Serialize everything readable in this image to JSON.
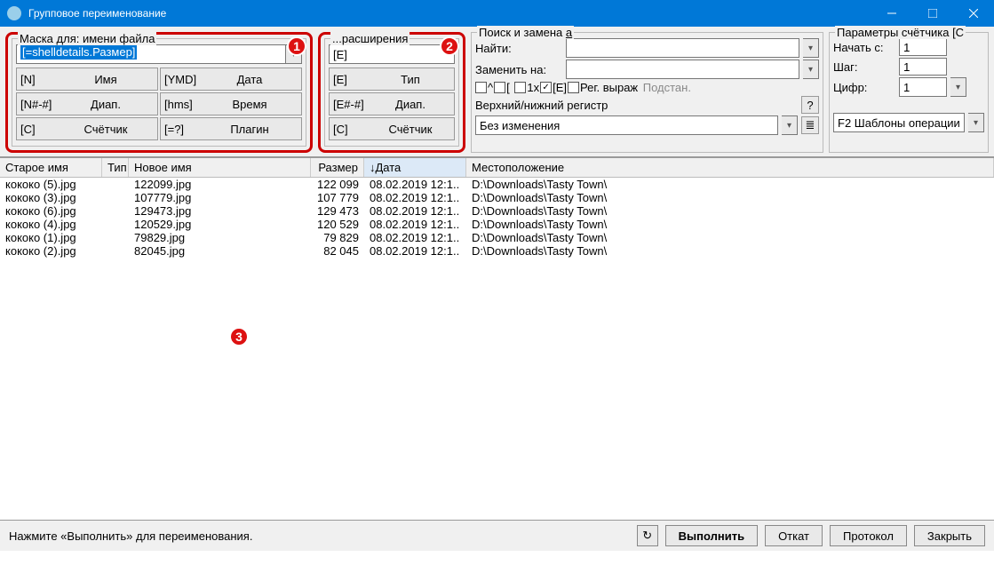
{
  "window": {
    "title": "Групповое переименование"
  },
  "badges": {
    "b1": "1",
    "b2": "2",
    "b3": "3"
  },
  "filename_mask": {
    "title": "Маска для: имени файла",
    "value": "[=shelldetails.Размер]",
    "buttons": [
      {
        "tag": "[N]",
        "label": "Имя"
      },
      {
        "tag": "[YMD]",
        "label": "Дата"
      },
      {
        "tag": "[N#-#]",
        "label": "Диап."
      },
      {
        "tag": "[hms]",
        "label": "Время"
      },
      {
        "tag": "[C]",
        "label": "Счётчик"
      },
      {
        "tag": "[=?]",
        "label": "Плагин"
      }
    ]
  },
  "ext_mask": {
    "title": "...расширения",
    "value": "[E]",
    "buttons": [
      {
        "tag": "[E]",
        "label": "Тип"
      },
      {
        "tag": "[E#-#]",
        "label": "Диап."
      },
      {
        "tag": "[C]",
        "label": "Счётчик"
      }
    ]
  },
  "search_replace": {
    "title": "Поиск и замена",
    "find_label": "Найти:",
    "replace_label": "Заменить на:",
    "opts": {
      "caret": "^",
      "bracket": "[",
      "one_x": "1x",
      "e": "[E]",
      "regex": "Рег. выраж",
      "subst": "Подстан."
    },
    "case_label": "Верхний/нижний регистр",
    "case_value": "Без изменения"
  },
  "counter": {
    "title": "Параметры счётчика  [C",
    "start_label": "Начать с:",
    "start_value": "1",
    "step_label": "Шаг:",
    "step_value": "1",
    "digits_label": "Цифр:",
    "digits_value": "1",
    "templates_label": "F2 Шаблоны операции"
  },
  "columns": {
    "old": "Старое имя",
    "type": "Тип",
    "new": "Новое имя",
    "size": "Размер",
    "date": "Дата",
    "loc": "Местоположение",
    "sort_arrow": "↓"
  },
  "rows": [
    {
      "old": "кококо (5).jpg",
      "new": "122099.jpg",
      "size": "122 099",
      "date": "08.02.2019 12:1..",
      "loc": "D:\\Downloads\\Tasty Town\\"
    },
    {
      "old": "кококо (3).jpg",
      "new": "107779.jpg",
      "size": "107 779",
      "date": "08.02.2019 12:1..",
      "loc": "D:\\Downloads\\Tasty Town\\"
    },
    {
      "old": "кококо (6).jpg",
      "new": "129473.jpg",
      "size": "129 473",
      "date": "08.02.2019 12:1..",
      "loc": "D:\\Downloads\\Tasty Town\\"
    },
    {
      "old": "кококо (4).jpg",
      "new": "120529.jpg",
      "size": "120 529",
      "date": "08.02.2019 12:1..",
      "loc": "D:\\Downloads\\Tasty Town\\"
    },
    {
      "old": "кококо (1).jpg",
      "new": "79829.jpg",
      "size": "79 829",
      "date": "08.02.2019 12:1..",
      "loc": "D:\\Downloads\\Tasty Town\\"
    },
    {
      "old": "кококо (2).jpg",
      "new": "82045.jpg",
      "size": "82 045",
      "date": "08.02.2019 12:1..",
      "loc": "D:\\Downloads\\Tasty Town\\"
    }
  ],
  "status": {
    "message": "Нажмите «Выполнить» для переименования.",
    "execute": "Выполнить",
    "undo": "Откат",
    "protocol": "Протокол",
    "close": "Закрыть"
  },
  "icons": {
    "help": "?",
    "list": "≣",
    "reload": "↻",
    "check": "✓"
  }
}
